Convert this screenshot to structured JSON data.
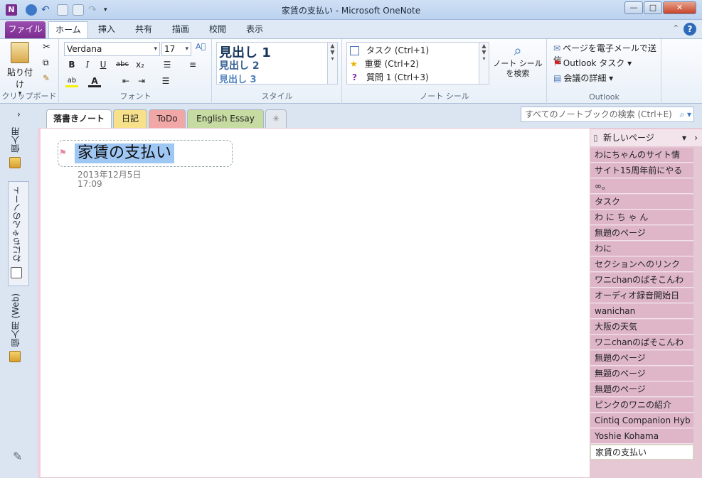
{
  "window": {
    "title": "家賃の支払い - Microsoft OneNote",
    "app_icon": "N",
    "controls": [
      "—",
      "□",
      "✕"
    ]
  },
  "ribbon_tabs": [
    {
      "label": "ファイル"
    },
    {
      "label": "ホーム"
    },
    {
      "label": "挿入"
    },
    {
      "label": "共有"
    },
    {
      "label": "描画"
    },
    {
      "label": "校閲"
    },
    {
      "label": "表示"
    }
  ],
  "clipboard": {
    "paste": "貼り付け",
    "group": "クリップボード"
  },
  "font": {
    "family": "Verdana",
    "size": "17",
    "group": "フォント",
    "bold": "B",
    "italic": "I",
    "underline": "U",
    "strike": "abc",
    "subscript": "x₂"
  },
  "styles": {
    "items": [
      "見出し 1",
      "見出し 2",
      "見出し 3"
    ],
    "group": "スタイル"
  },
  "tags": {
    "items": [
      {
        "label": "タスク (Ctrl+1)"
      },
      {
        "label": "重要 (Ctrl+2)"
      },
      {
        "label": "質問 1 (Ctrl+3)"
      }
    ],
    "search": "ノート シールを検索",
    "group": "ノート シール"
  },
  "outlook": {
    "email": "ページを電子メールで送信",
    "task": "Outlook タスク",
    "meeting": "会議の詳細",
    "group": "Outlook"
  },
  "notebooks": [
    "個人用",
    "わにちゃんのノート",
    "個人用 (Web)"
  ],
  "section_tabs": [
    {
      "label": "落書きノート",
      "color": "#ffffff"
    },
    {
      "label": "日記",
      "color": "#f7e08a"
    },
    {
      "label": "ToDo",
      "color": "#f2a7a7"
    },
    {
      "label": "English Essay",
      "color": "#c6dba1"
    },
    {
      "label": "✳",
      "color": "#e3e8ef"
    }
  ],
  "search": {
    "placeholder": "すべてのノートブックの検索 (Ctrl+E)"
  },
  "page": {
    "title": "家賃の支払い",
    "date": "2013年12月5日",
    "time": "17:09"
  },
  "pagelist": {
    "new_page": "新しいページ",
    "items": [
      "わにちゃんのサイト情",
      "サイト15周年前にやる",
      "∞。",
      "タスク",
      "わ に ち ゃ ん",
      "無題のページ",
      "わに",
      "セクションへのリンク",
      "ワニchanのぱそこんわ",
      "オーディオ録音開始日",
      "wanichan",
      "大阪の天気",
      "ワニchanのぱそこんわ",
      "無題のページ",
      "無題のページ",
      "無題のページ",
      "ピンクのワニの紹介",
      "Cintiq Companion Hyb",
      "Yoshie Kohama",
      "家賃の支払い"
    ],
    "selected_index": 19
  }
}
